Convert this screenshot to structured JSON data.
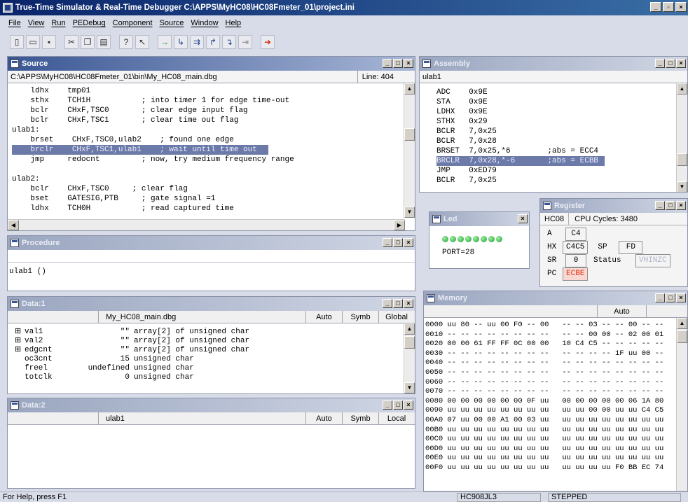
{
  "app": {
    "title": "True-Time Simulator & Real-Time Debugger  C:\\APPS\\MyHC08\\HC08Fmeter_01\\project.ini"
  },
  "menu": [
    "File",
    "View",
    "Run",
    "PEDebug",
    "Component",
    "Source",
    "Window",
    "Help"
  ],
  "toolbar_icons": [
    "new-icon",
    "open-icon",
    "save-icon",
    "cut-icon",
    "copy-icon",
    "paste-icon",
    "help-icon",
    "context-help-icon",
    "start-icon",
    "single-step-icon",
    "step-over-icon",
    "step-out-icon",
    "assembly-step-icon",
    "halt-icon",
    "reset-icon"
  ],
  "source": {
    "title": "Source",
    "path": "C:\\APPS\\MyHC08\\HC08Fmeter_01\\bin\\My_HC08_main.dbg",
    "line": "Line: 404",
    "lines": [
      "    ldhx    tmp01",
      "    sthx    TCH1H           ; into timer 1 for edge time-out",
      "    bclr    CHxF,TSC0       ; clear edge input flag",
      "    bclr    CHxF,TSC1       ; clear time out flag",
      "ulab1:",
      "    brset    CHxF,TSC0,ulab2    ; found one edge",
      "    brclr    CHxF,TSC1,ulab1    ; wait until time out",
      "    jmp     redocnt         ; now, try medium frequency range",
      "",
      "ulab2:",
      "    bclr    CHxF,TSC0     ; clear flag",
      "    bset    GATESIG,PTB     ; gate signal =1",
      "    ldhx    TCH0H           ; read captured time"
    ],
    "highlight_index": 6
  },
  "procedure": {
    "title": "Procedure",
    "text": "ulab1 ()"
  },
  "data1": {
    "title": "Data:1",
    "header": {
      "module": "My_HC08_main.dbg",
      "mode": "Auto",
      "format": "Symb",
      "scope": "Global"
    },
    "rows": [
      {
        "exp": "⊞",
        "name": "val1",
        "value": "\"\"",
        "type": "array[2] of unsigned char"
      },
      {
        "exp": "⊞",
        "name": "val2",
        "value": "\"\"",
        "type": "array[2] of unsigned char"
      },
      {
        "exp": "⊞",
        "name": "edgcnt",
        "value": "\"\"",
        "type": "array[2] of unsigned char"
      },
      {
        "exp": "",
        "name": "oc3cnt",
        "value": "15",
        "type": "unsigned char"
      },
      {
        "exp": "",
        "name": "freel",
        "value": "undefined",
        "type": "unsigned char"
      },
      {
        "exp": "",
        "name": "totclk",
        "value": "0",
        "type": "unsigned char"
      }
    ]
  },
  "data2": {
    "title": "Data:2",
    "header": {
      "module": "ulab1",
      "mode": "Auto",
      "format": "Symb",
      "scope": "Local"
    }
  },
  "assembly": {
    "title": "Assembly",
    "label": "ulab1",
    "lines": [
      "ADC    0x9E",
      "STA    0x9E",
      "LDHX   0x9E",
      "STHX   0x29",
      "BCLR   7,0x25",
      "BCLR   7,0x28",
      "BRSET  7,0x25,*6        ;abs = ECC4",
      "BRCLR  7,0x28,*-6       ;abs = ECBB",
      "JMP    0xED79",
      "BCLR   7,0x25"
    ],
    "highlight_index": 7
  },
  "led": {
    "title": "Led",
    "port": "PORT=28",
    "count": 8
  },
  "register": {
    "title": "Register",
    "cpu": "HC08",
    "cycles": "CPU Cycles: 3480",
    "a_label": "A",
    "a_value": "C4",
    "hx_label": "HX",
    "hx_value": "C4C5",
    "sp_label": "SP",
    "sp_value": "FD",
    "sr_label": "SR",
    "sr_value": "0",
    "status_label": "Status",
    "status_value": "VHINZC",
    "pc_label": "PC",
    "pc_value": "ECBE"
  },
  "memory": {
    "title": "Memory",
    "mode": "Auto",
    "rows": [
      "0000 uu 80 -- uu 00 F0 -- 00   -- -- 03 -- -- 00 -- --",
      "0010 -- -- -- -- -- -- -- --   -- -- 00 00 -- 02 00 01",
      "0020 00 00 61 FF FF 0C 00 00   10 C4 C5 -- -- -- -- --",
      "0030 -- -- -- -- -- -- -- --   -- -- -- -- 1F uu 00 --",
      "0040 -- -- -- -- -- -- -- --   -- -- -- -- -- -- -- --",
      "0050 -- -- -- -- -- -- -- --   -- -- -- -- -- -- -- --",
      "0060 -- -- -- -- -- -- -- --   -- -- -- -- -- -- -- --",
      "0070 -- -- -- -- -- -- -- --   -- -- -- -- -- -- -- --",
      "0080 00 00 00 00 00 00 0F uu   00 00 00 00 00 06 1A 80",
      "0090 uu uu uu uu uu uu uu uu   uu uu 00 00 uu uu C4 C5",
      "00A0 07 uu 00 00 A1 00 03 uu   uu uu uu uu uu uu uu uu",
      "00B0 uu uu uu uu uu uu uu uu   uu uu uu uu uu uu uu uu",
      "00C0 uu uu uu uu uu uu uu uu   uu uu uu uu uu uu uu uu",
      "00D0 uu uu uu uu uu uu uu uu   uu uu uu uu uu uu uu uu",
      "00E0 uu uu uu uu uu uu uu uu   uu uu uu uu uu uu uu uu",
      "00F0 uu uu uu uu uu uu uu uu   uu uu uu uu F0 BB EC 74"
    ]
  },
  "status": {
    "help": "For Help, press F1",
    "device": "HC908JL3",
    "state": "STEPPED"
  }
}
